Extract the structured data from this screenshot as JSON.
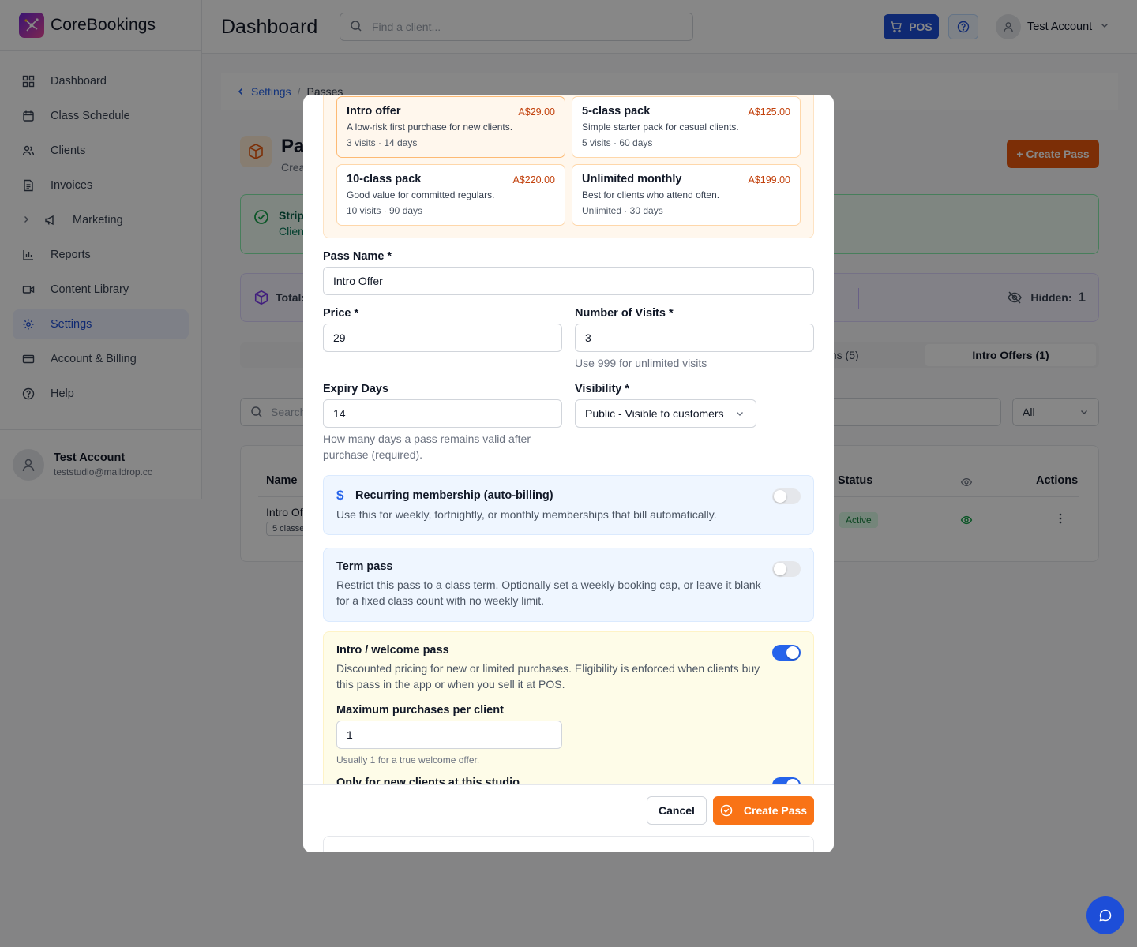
{
  "app": {
    "name": "CoreBookings"
  },
  "sidebar": {
    "items": [
      {
        "label": "Dashboard",
        "icon": "grid-icon"
      },
      {
        "label": "Class Schedule",
        "icon": "calendar-icon"
      },
      {
        "label": "Clients",
        "icon": "users-icon"
      },
      {
        "label": "Invoices",
        "icon": "document-icon"
      },
      {
        "label": "Marketing",
        "icon": "megaphone-icon"
      },
      {
        "label": "Reports",
        "icon": "bar-chart-icon"
      },
      {
        "label": "Content Library",
        "icon": "video-icon"
      },
      {
        "label": "Settings",
        "icon": "gear-icon",
        "active": true
      },
      {
        "label": "Account & Billing",
        "icon": "card-icon"
      },
      {
        "label": "Help",
        "icon": "help-circle-icon"
      }
    ],
    "user": {
      "name": "Test Account",
      "email": "teststudio@maildrop.cc"
    }
  },
  "topbar": {
    "title": "Dashboard",
    "search_placeholder": "Find a client...",
    "pos_label": "POS",
    "account_name": "Test Account"
  },
  "page": {
    "breadcrumb": {
      "parent": "Settings",
      "current": "Passes"
    },
    "title": "Pa",
    "subtitle": "Crea",
    "create_button": "+ Create Pass",
    "stripe": {
      "title": "Stripe",
      "sub": "Clien"
    },
    "stats": {
      "total_label": "Total:",
      "hidden_label": "Hidden:",
      "hidden_value": "1"
    },
    "tabs": {
      "memberships": "ms (5)",
      "intro": "Intro Offers (1)"
    },
    "search_placeholder": "Search",
    "filter_value": "All",
    "table": {
      "headers": {
        "name": "Name",
        "status": "Status",
        "actions": "Actions"
      },
      "row": {
        "name": "Intro Of",
        "classes": "5 classe",
        "status": "Active"
      }
    }
  },
  "modal": {
    "templates": [
      {
        "title": "Intro offer",
        "price": "A$29.00",
        "desc": "A low-risk first purchase for new clients.",
        "meta": "3 visits · 14 days",
        "selected": true
      },
      {
        "title": "5-class pack",
        "price": "A$125.00",
        "desc": "Simple starter pack for casual clients.",
        "meta": "5 visits · 60 days"
      },
      {
        "title": "10-class pack",
        "price": "A$220.00",
        "desc": "Good value for committed regulars.",
        "meta": "10 visits · 90 days"
      },
      {
        "title": "Unlimited monthly",
        "price": "A$199.00",
        "desc": "Best for clients who attend often.",
        "meta": "Unlimited · 30 days"
      }
    ],
    "fields": {
      "pass_name_label": "Pass Name *",
      "pass_name_value": "Intro Offer",
      "price_label": "Price *",
      "price_value": "29",
      "visits_label": "Number of Visits *",
      "visits_value": "3",
      "visits_hint": "Use 999 for unlimited visits",
      "expiry_label": "Expiry Days",
      "expiry_value": "14",
      "expiry_hint": "How many days a pass remains valid after purchase (required).",
      "visibility_label": "Visibility *",
      "visibility_value": "Public - Visible to customers"
    },
    "recurring": {
      "title": "Recurring membership (auto-billing)",
      "desc": "Use this for weekly, fortnightly, or monthly memberships that bill automatically.",
      "enabled": false
    },
    "term": {
      "title": "Term pass",
      "desc": "Restrict this pass to a class term. Optionally set a weekly booking cap, or leave it blank for a fixed class count with no weekly limit.",
      "enabled": false
    },
    "intro": {
      "title": "Intro / welcome pass",
      "desc": "Discounted pricing for new or limited purchases. Eligibility is enforced when clients buy this pass in the app or when you sell it at POS.",
      "enabled": true,
      "max_label": "Maximum purchases per client",
      "max_value": "1",
      "max_hint": "Usually 1 for a true welcome offer.",
      "new_clients_label": "Only for new clients at this studio",
      "new_clients_enabled": true
    },
    "cancel_label": "Cancel",
    "create_label": "Create Pass"
  },
  "colors": {
    "accent": "#f97316",
    "primary": "#1d4ed8",
    "toggle_on": "#2563eb"
  }
}
